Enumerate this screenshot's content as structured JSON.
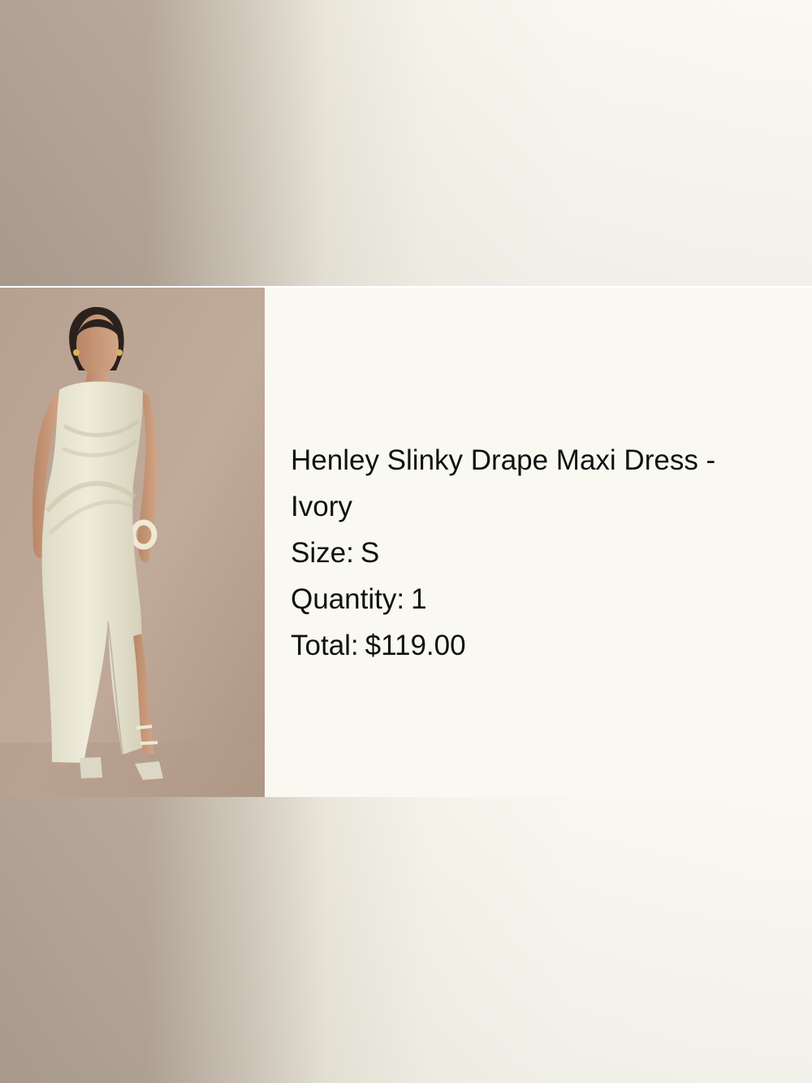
{
  "product": {
    "name_line1": "Henley Slinky Drape Maxi Dress -",
    "name_line2": "Ivory",
    "size_label": "Size:",
    "size_value": "S",
    "quantity_label": "Quantity:",
    "quantity_value": "1",
    "total_label": "Total:",
    "total_value": "$119.00"
  },
  "colors": {
    "background": "#f9f8f0",
    "photo_backdrop": "#bea897",
    "dress": "#e9e6d3",
    "text": "#111111"
  }
}
